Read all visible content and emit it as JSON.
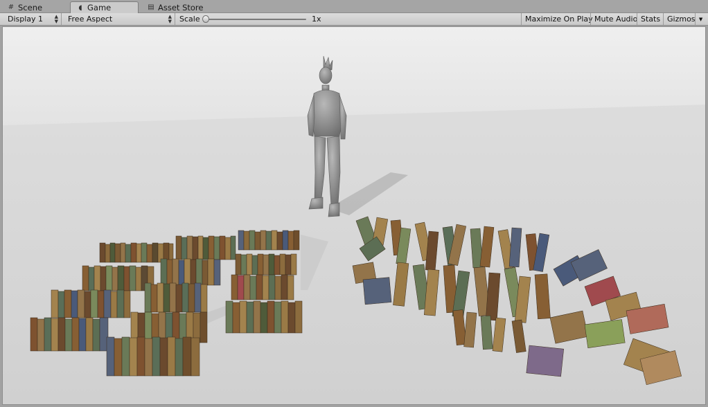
{
  "tabs": [
    {
      "label": "Scene",
      "icon": "grid-icon"
    },
    {
      "label": "Game",
      "icon": "pacman-icon",
      "active": true
    },
    {
      "label": "Asset Store",
      "icon": "store-icon"
    }
  ],
  "toolbar": {
    "display": "Display 1",
    "aspect": "Free Aspect",
    "scale_label": "Scale",
    "scale_value": "1x",
    "maximize": "Maximize On Play",
    "mute": "Mute Audio",
    "stats": "Stats",
    "gizmos": "Gizmos"
  },
  "colors": {
    "wall": "#e9e9e9",
    "floor": "#dadada",
    "character": "#8f8f8f"
  }
}
